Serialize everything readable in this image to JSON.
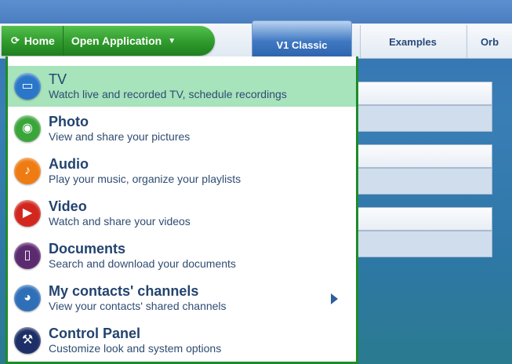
{
  "nav": {
    "home_label": "Home",
    "open_app_label": "Open Application",
    "home_icon": "refresh-icon",
    "dropdown_icon": "caret-down-icon"
  },
  "tabs": [
    {
      "label": "V1 Classic",
      "active": true
    },
    {
      "label": "Examples",
      "active": false
    },
    {
      "label": "Orb",
      "active": false
    }
  ],
  "menu": {
    "items": [
      {
        "title": "TV",
        "description": "Watch live and recorded TV, schedule recordings",
        "icon": "tv-icon",
        "color": "#2a77c9",
        "hover": true
      },
      {
        "title": "Photo",
        "description": "View and share your pictures",
        "icon": "camera-icon",
        "color": "#3aa53a"
      },
      {
        "title": "Audio",
        "description": "Play your music, organize your playlists",
        "icon": "music-note-icon",
        "color": "#ee7c12"
      },
      {
        "title": "Video",
        "description": "Watch and share your videos",
        "icon": "film-camera-icon",
        "color": "#d2261e"
      },
      {
        "title": "Documents",
        "description": "Search and download your documents",
        "icon": "document-icon",
        "color": "#5b2a6f"
      },
      {
        "title": "My contacts' channels",
        "description": "View your contacts' shared channels",
        "icon": "contacts-globe-icon",
        "color": "#2f6fb8",
        "submenu": true
      },
      {
        "title": "Control Panel",
        "description": "Customize look and system options",
        "icon": "control-panel-icon",
        "color": "#1d2f66"
      }
    ]
  }
}
